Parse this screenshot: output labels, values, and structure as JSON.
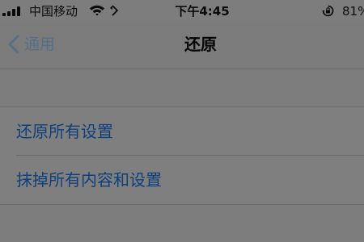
{
  "status_bar": {
    "carrier": "中国移动",
    "time": "下午4:45",
    "battery": "81%",
    "icons": [
      "signal-icon",
      "wifi-icon",
      "location-icon",
      "rotation-lock-icon"
    ]
  },
  "nav": {
    "back_label": "通用",
    "title": "还原"
  },
  "reset_options": [
    {
      "label": "还原所有设置"
    },
    {
      "label": "抹掉所有内容和设置"
    }
  ],
  "colors": {
    "background": "#7d7d7d",
    "link_blue": "#0f3f7d",
    "back_label": "#566f86",
    "text_dark": "#050505"
  }
}
